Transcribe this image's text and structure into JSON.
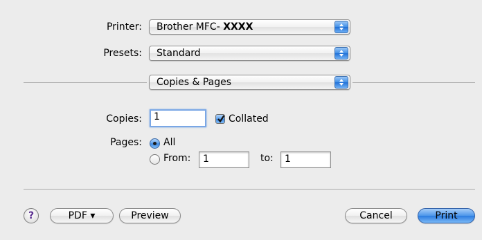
{
  "printer": {
    "label": "Printer:",
    "value_prefix": "Brother MFC- ",
    "value_model": "XXXX"
  },
  "presets": {
    "label": "Presets:",
    "value": "Standard"
  },
  "panel": {
    "value": "Copies & Pages"
  },
  "copies": {
    "label": "Copies:",
    "value": "1",
    "collated_label": "Collated",
    "collated_checked": true
  },
  "pages": {
    "label": "Pages:",
    "all_label": "All",
    "from_label": "From:",
    "from_value": "1",
    "to_label": "to:",
    "to_value": "1",
    "selected": "All"
  },
  "footer": {
    "help_label": "?",
    "pdf_label": "PDF ▾",
    "preview_label": "Preview",
    "cancel_label": "Cancel",
    "print_label": "Print"
  },
  "colors": {
    "accent": "#3a86e1",
    "background": "#ececec"
  }
}
